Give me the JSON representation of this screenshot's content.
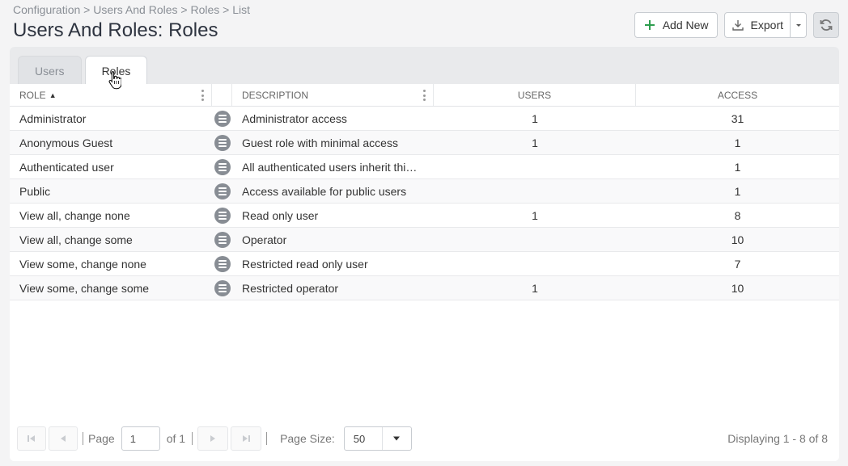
{
  "breadcrumb": "Configuration > Users And Roles > Roles > List",
  "title": "Users And Roles: Roles",
  "toolbar": {
    "add_new": "Add New",
    "export": "Export",
    "icons": {
      "add": "plus-icon",
      "export": "download-icon",
      "dropdown": "caret-down-icon",
      "refresh": "refresh-icon"
    }
  },
  "tabs": [
    {
      "label": "Users",
      "active": false
    },
    {
      "label": "Roles",
      "active": true
    }
  ],
  "grid": {
    "columns": {
      "role": "ROLE",
      "description": "DESCRIPTION",
      "users": "USERS",
      "access": "ACCESS"
    },
    "sort": "ascending",
    "rows": [
      {
        "role": "Administrator",
        "description": "Administrator access",
        "users": "1",
        "access": "31"
      },
      {
        "role": "Anonymous Guest",
        "description": "Guest role with minimal access",
        "users": "1",
        "access": "1"
      },
      {
        "role": "Authenticated user",
        "description": "All authenticated users inherit thi…",
        "users": "",
        "access": "1"
      },
      {
        "role": "Public",
        "description": "Access available for public users",
        "users": "",
        "access": "1"
      },
      {
        "role": "View all, change none",
        "description": "Read only user",
        "users": "1",
        "access": "8"
      },
      {
        "role": "View all, change some",
        "description": "Operator",
        "users": "",
        "access": "10"
      },
      {
        "role": "View some, change none",
        "description": "Restricted read only user",
        "users": "",
        "access": "7"
      },
      {
        "role": "View some, change some",
        "description": "Restricted operator",
        "users": "1",
        "access": "10"
      }
    ]
  },
  "pager": {
    "page_label": "Page",
    "page_value": "1",
    "of_label": "of 1",
    "page_size_label": "Page Size:",
    "page_size_value": "50",
    "displaying": "Displaying 1 - 8 of 8"
  },
  "colors": {
    "add_icon": "#2e9e4f",
    "accent": "#2e3440"
  }
}
